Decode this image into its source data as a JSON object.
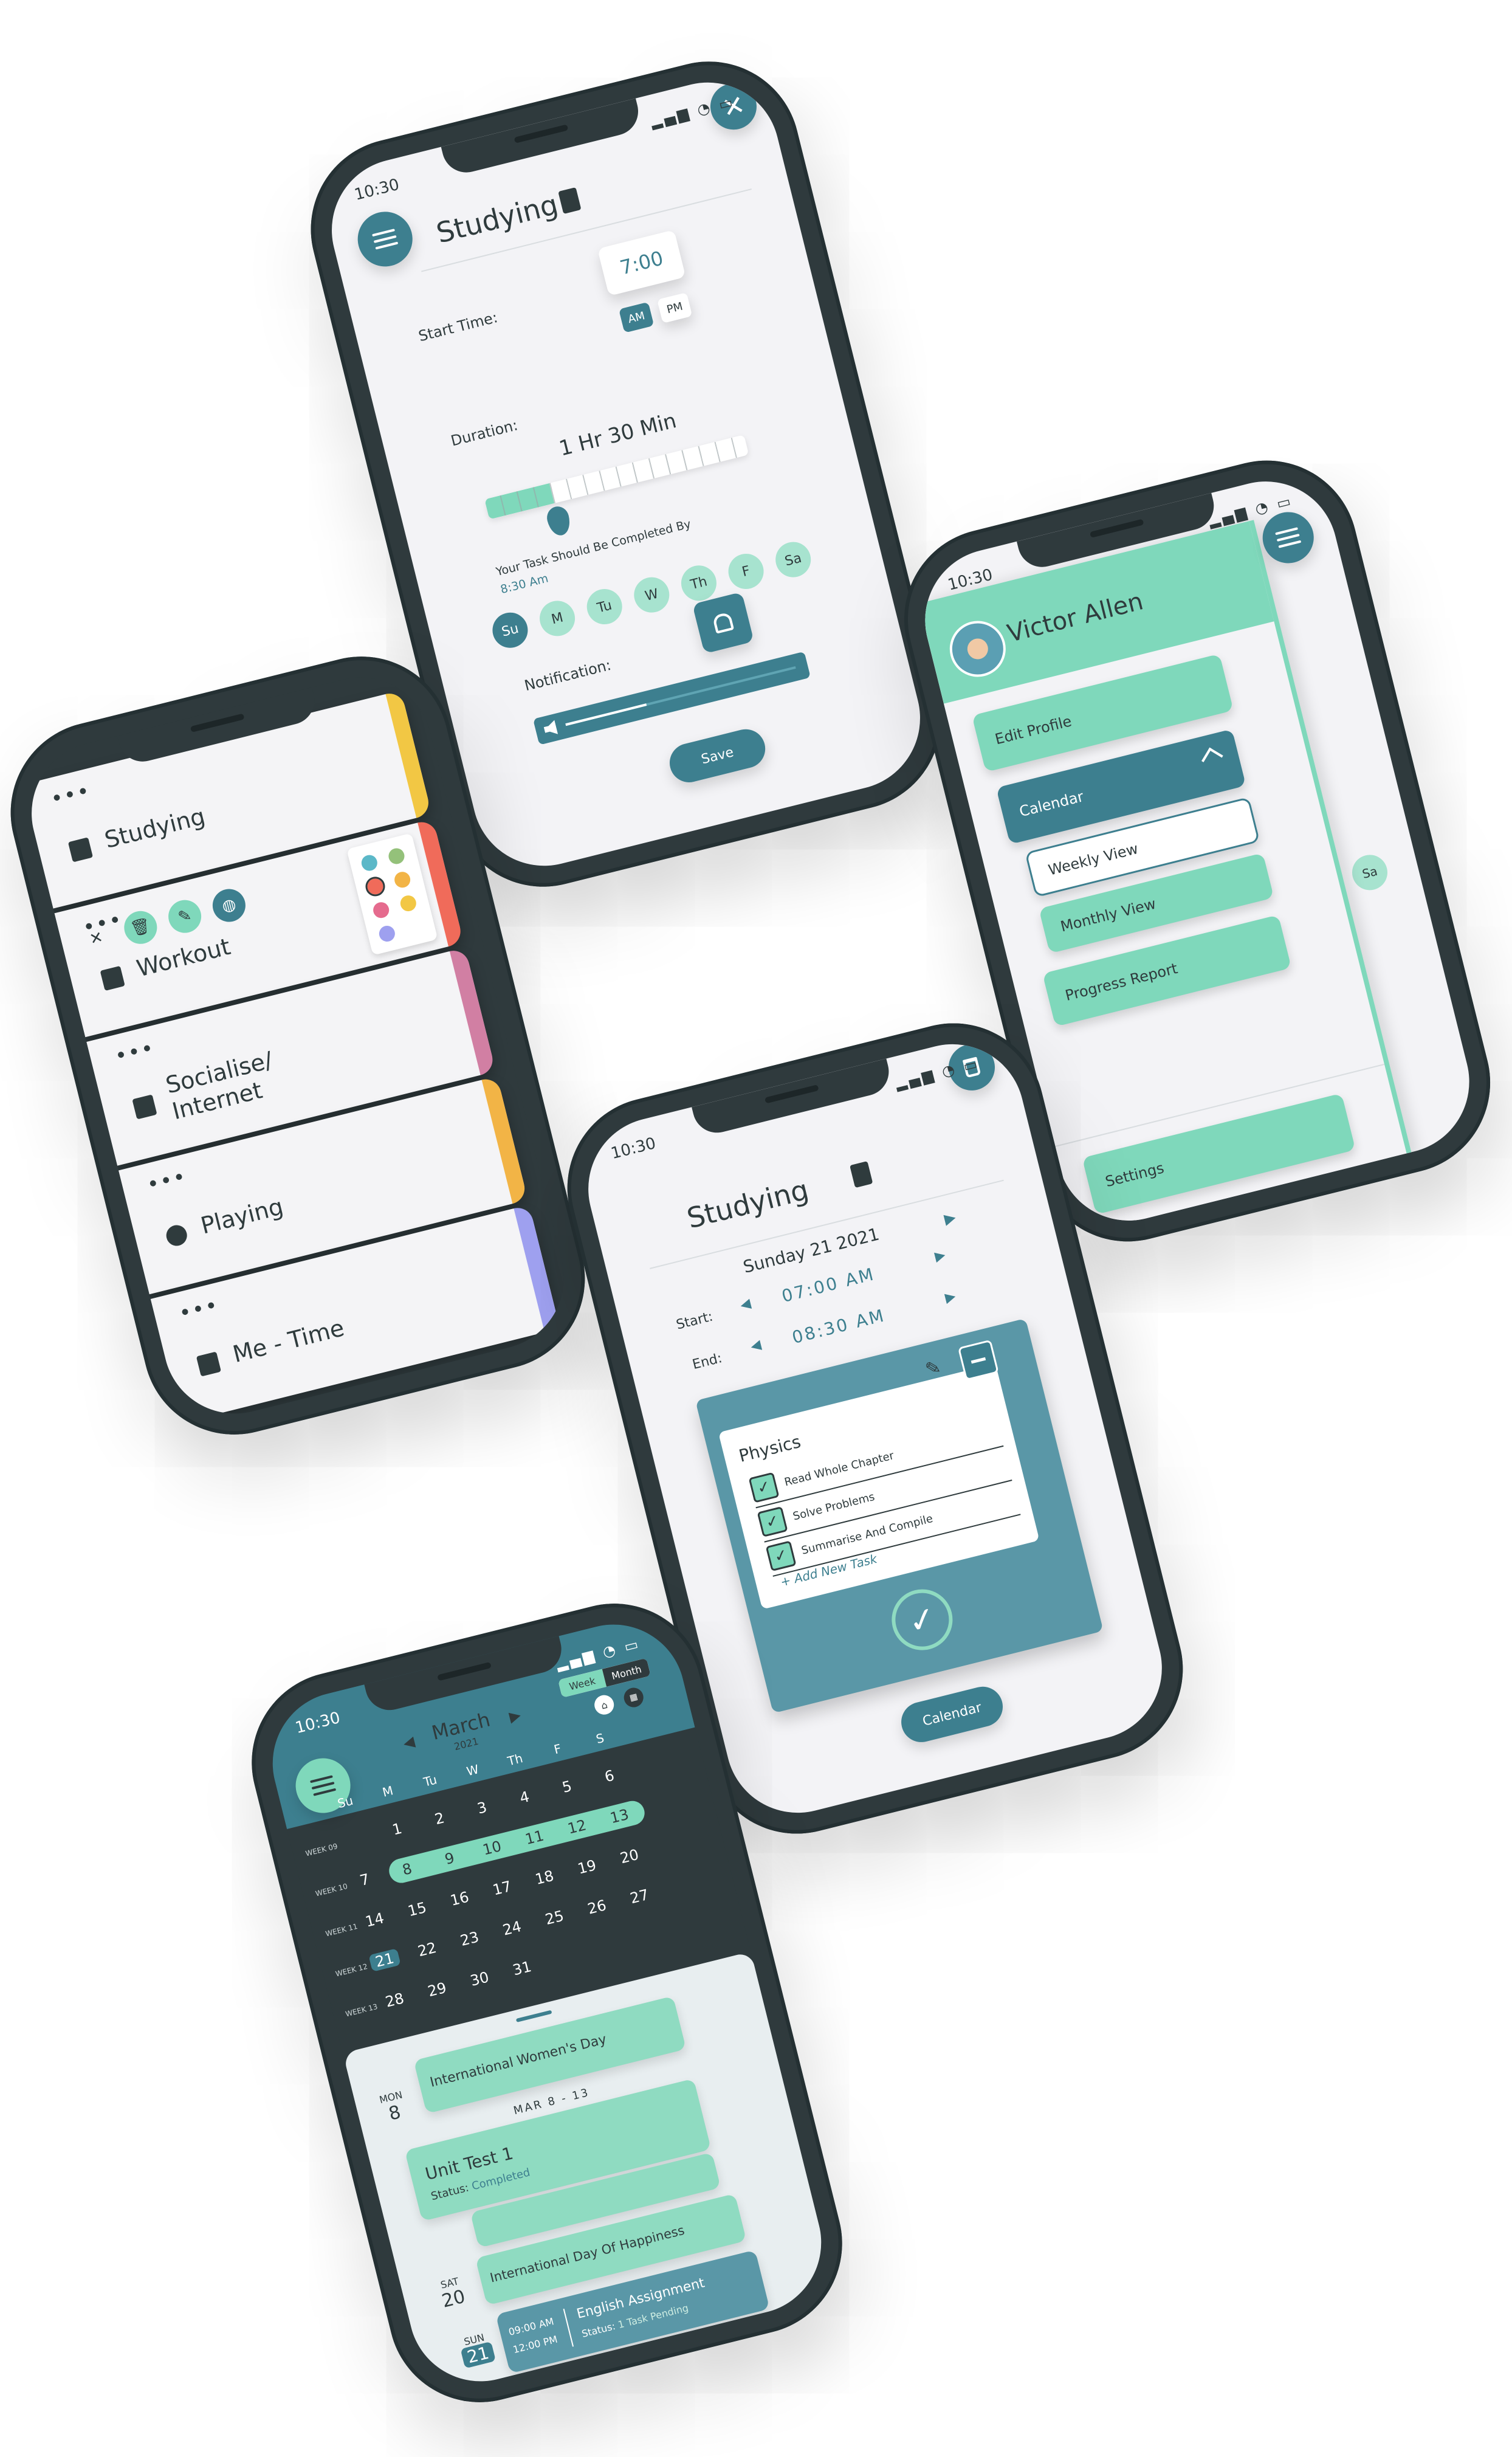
{
  "colors": {
    "teal": "#3d7f8f",
    "mint": "#7fd8bb",
    "frame": "#2f3a3d",
    "screen": "#f3f3f6"
  },
  "status_time": "10:30",
  "studying_form": {
    "title": "Studying",
    "title_icon": "book-icon",
    "start_time_label": "Start Time:",
    "start_time_value": "7:00",
    "am": "AM",
    "pm": "PM",
    "duration_label": "Duration:",
    "duration_value": "1 Hr 30 Min",
    "duration_fraction": 0.25,
    "completed_by_label": "Your Task Should Be Completed By",
    "completed_by_value": "8:30 Am",
    "days": [
      "Su",
      "M",
      "Tu",
      "W",
      "Th",
      "F",
      "Sa"
    ],
    "days_selected": [
      0
    ],
    "notification_label": "Notification:",
    "volume_fraction": 0.35,
    "save": "Save"
  },
  "menu": {
    "user_name": "Victor Allen",
    "edit_profile": "Edit Profile",
    "calendar": "Calendar",
    "weekly_view": "Weekly View",
    "monthly_view": "Monthly View",
    "progress_report": "Progress Report",
    "settings": "Settings",
    "behind_label": "Sa"
  },
  "activities": {
    "items": [
      {
        "title": "Studying",
        "icon": "book-icon",
        "color": "#f2c744"
      },
      {
        "title": "Workout",
        "icon": "dumbbell-icon",
        "color": "#f06b5a"
      },
      {
        "title": "Socialise/\nInternet",
        "icon": "laptop-icon",
        "color": "#d17fa3"
      },
      {
        "title": "Playing",
        "icon": "basketball-icon",
        "color": "#f2b446"
      },
      {
        "title": "Me - Time",
        "icon": "coffee-icon",
        "color": "#9ea0ef"
      }
    ],
    "palette": [
      "#5bb8c8",
      "#94c17a",
      "#f06b5a",
      "#f2b446",
      "#e56b8e",
      "#f2c744",
      "#9ea0ef"
    ]
  },
  "tasks": {
    "title": "Studying",
    "date": "Sunday 21 2021",
    "start_label": "Start:",
    "start_value": "07:00 AM",
    "end_label": "End:",
    "end_value": "08:30 AM",
    "subject": "Physics",
    "items": [
      "Read Whole Chapter",
      "Solve Problems",
      "Summarise And Compile"
    ],
    "add_new": "Add New Task",
    "calendar_button": "Calendar"
  },
  "calendar": {
    "month": "March",
    "year": "2021",
    "toggle_week": "Week",
    "toggle_month": "Month",
    "weekday_headers": [
      "Su",
      "M",
      "Tu",
      "W",
      "Th",
      "F",
      "S"
    ],
    "header_row": [
      "1",
      "2",
      "3",
      "4",
      "5",
      "6"
    ],
    "weeks": [
      {
        "label": "WEEK 09",
        "days": [
          "",
          "1",
          "2",
          "3",
          "4",
          "5",
          "6"
        ]
      },
      {
        "label": "WEEK 10",
        "days": [
          "7",
          "8",
          "9",
          "10",
          "11",
          "12",
          "13"
        ]
      },
      {
        "label": "WEEK 11",
        "days": [
          "14",
          "15",
          "16",
          "17",
          "18",
          "19",
          "20"
        ]
      },
      {
        "label": "WEEK 12",
        "days": [
          "21",
          "22",
          "23",
          "24",
          "25",
          "26",
          "27"
        ]
      },
      {
        "label": "WEEK 13",
        "days": [
          "28",
          "29",
          "30",
          "31",
          "",
          "",
          ""
        ]
      }
    ],
    "events": {
      "mon": "MON",
      "mon_num": "8",
      "womens_day": "International Women's Day",
      "range": "MAR 8 - 13",
      "unit_test": "Unit Test 1",
      "status_label": "Status:",
      "unit_status": "Completed",
      "sat": "SAT",
      "sat_num": "20",
      "happiness": "International Day Of Happiness",
      "sun": "SUN",
      "sun_num": "21",
      "time1": "09:00 AM",
      "time2": "12:00 PM",
      "english": "English Assignment",
      "english_status": "1 Task Pending"
    }
  }
}
